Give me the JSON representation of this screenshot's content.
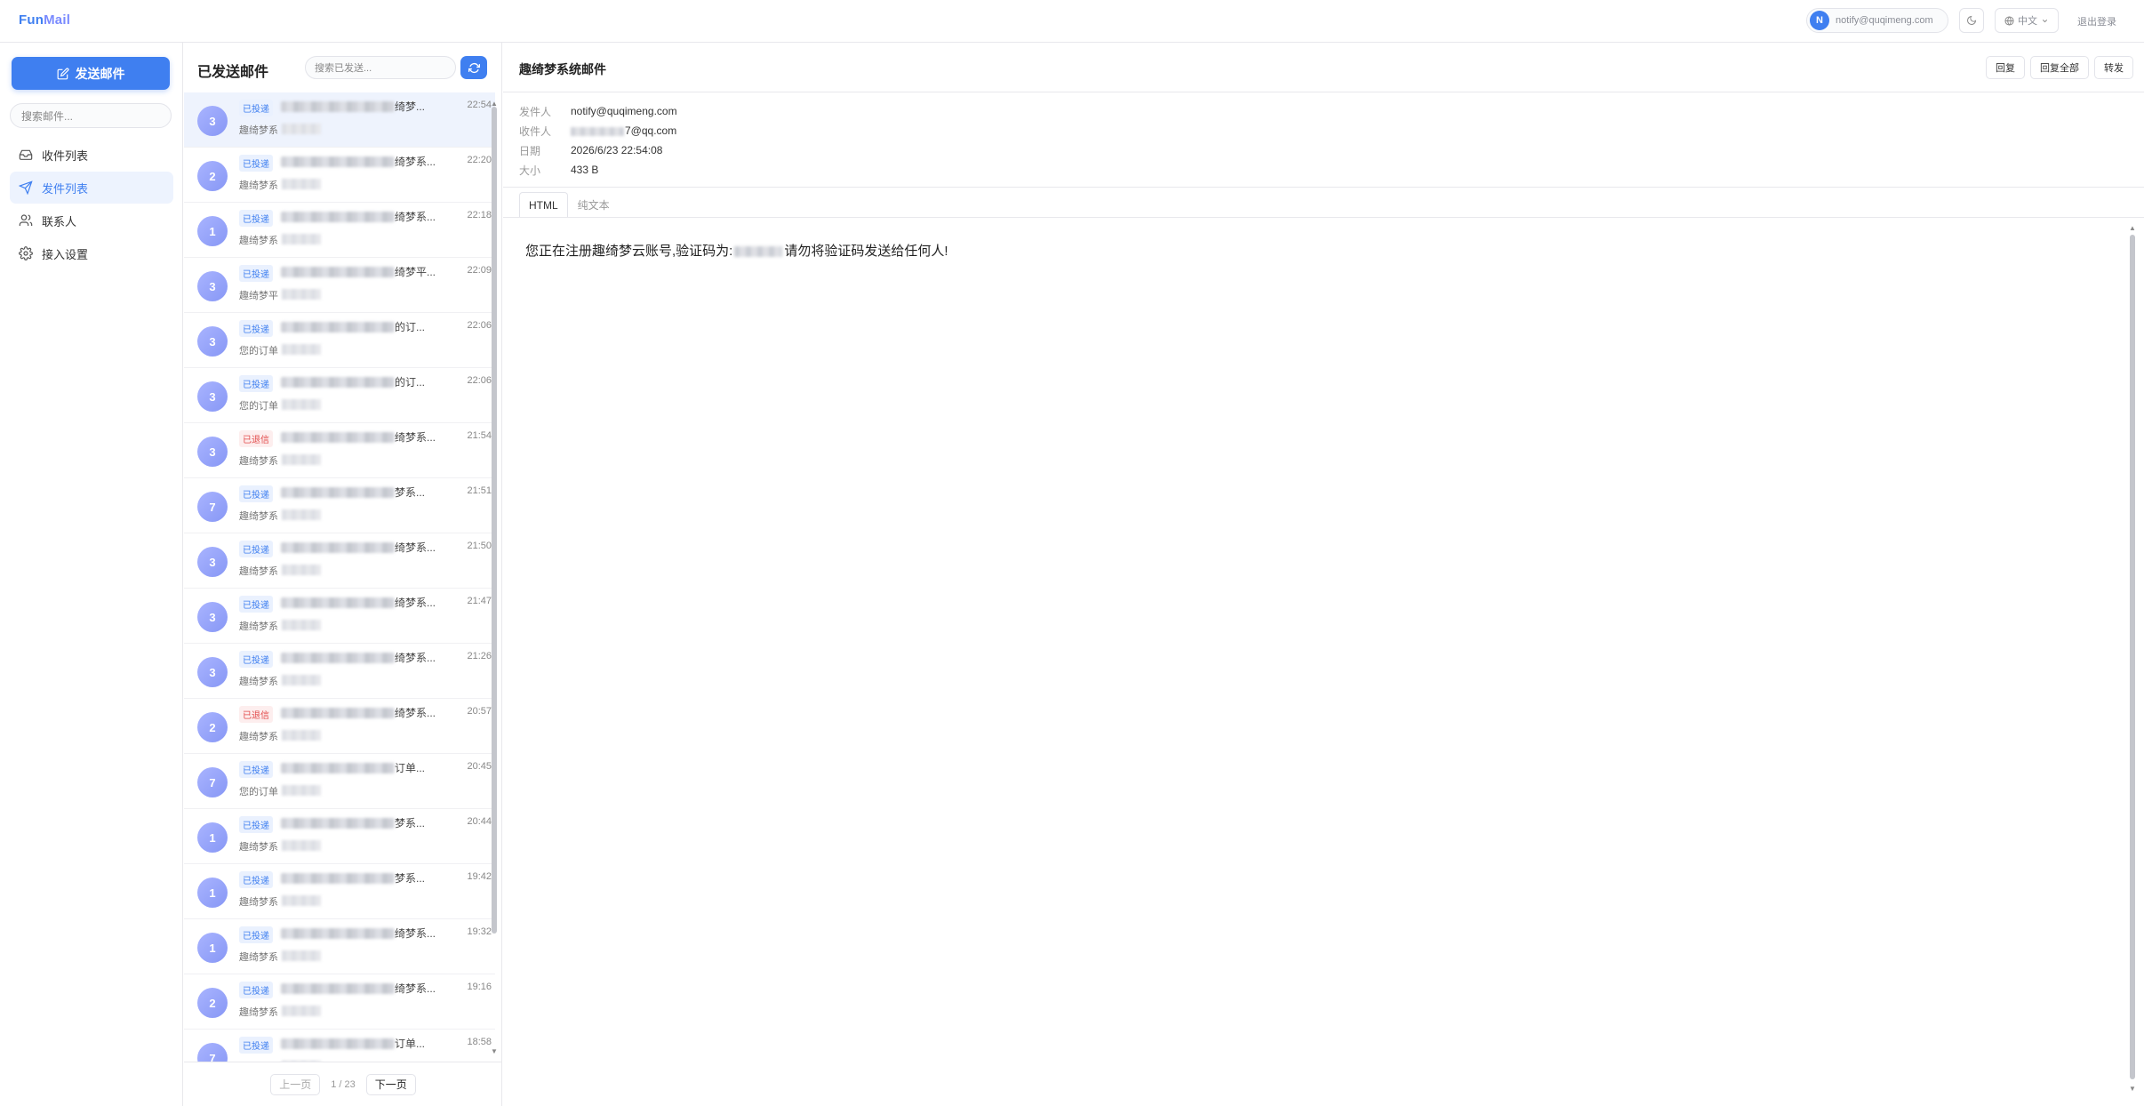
{
  "app": {
    "logo_main": "Fun",
    "logo_accent": "Mail"
  },
  "topbar": {
    "user_initial": "N",
    "user_email": "notify@quqimeng.com",
    "lang_label": "中文",
    "logout_label": "退出登录"
  },
  "sidebar": {
    "compose_label": "发送邮件",
    "search_placeholder": "搜索邮件...",
    "items": [
      {
        "label": "收件列表",
        "icon": "inbox-icon"
      },
      {
        "label": "发件列表",
        "icon": "send-icon"
      },
      {
        "label": "联系人",
        "icon": "contacts-icon"
      },
      {
        "label": "接入设置",
        "icon": "gear-icon"
      }
    ]
  },
  "list": {
    "title": "已发送邮件",
    "search_placeholder": "搜索已发送...",
    "items": [
      {
        "count": "3",
        "status": "已投递",
        "subject": "绮梦...",
        "time": "22:54",
        "from": "趣绮梦系"
      },
      {
        "count": "2",
        "status": "已投递",
        "subject": "绮梦系...",
        "time": "22:20",
        "from": "趣绮梦系"
      },
      {
        "count": "1",
        "status": "已投递",
        "subject": "绮梦系...",
        "time": "22:18",
        "from": "趣绮梦系"
      },
      {
        "count": "3",
        "status": "已投递",
        "subject": "绮梦平...",
        "time": "22:09",
        "from": "趣绮梦平"
      },
      {
        "count": "3",
        "status": "已投递",
        "subject": "的订...",
        "time": "22:06",
        "from": "您的订单"
      },
      {
        "count": "3",
        "status": "已投递",
        "subject": "的订...",
        "time": "22:06",
        "from": "您的订单"
      },
      {
        "count": "3",
        "status": "已退信",
        "subject": "绮梦系...",
        "time": "21:54",
        "from": "趣绮梦系"
      },
      {
        "count": "7",
        "status": "已投递",
        "subject": "梦系...",
        "time": "21:51",
        "from": "趣绮梦系"
      },
      {
        "count": "3",
        "status": "已投递",
        "subject": "绮梦系...",
        "time": "21:50",
        "from": "趣绮梦系"
      },
      {
        "count": "3",
        "status": "已投递",
        "subject": "绮梦系...",
        "time": "21:47",
        "from": "趣绮梦系"
      },
      {
        "count": "3",
        "status": "已投递",
        "subject": "绮梦系...",
        "time": "21:26",
        "from": "趣绮梦系"
      },
      {
        "count": "2",
        "status": "已退信",
        "subject": "绮梦系...",
        "time": "20:57",
        "from": "趣绮梦系"
      },
      {
        "count": "7",
        "status": "已投递",
        "subject": "订单...",
        "time": "20:45",
        "from": "您的订单"
      },
      {
        "count": "1",
        "status": "已投递",
        "subject": "梦系...",
        "time": "20:44",
        "from": "趣绮梦系"
      },
      {
        "count": "1",
        "status": "已投递",
        "subject": "梦系...",
        "time": "19:42",
        "from": "趣绮梦系"
      },
      {
        "count": "1",
        "status": "已投递",
        "subject": "绮梦系...",
        "time": "19:32",
        "from": "趣绮梦系"
      },
      {
        "count": "2",
        "status": "已投递",
        "subject": "绮梦系...",
        "time": "19:16",
        "from": "趣绮梦系"
      },
      {
        "count": "7",
        "status": "已投递",
        "subject": "订单...",
        "time": "18:58",
        "from": "您的订单"
      }
    ],
    "pager": {
      "prev": "上一页",
      "info": "1 / 23",
      "next": "下一页"
    }
  },
  "detail": {
    "title": "趣绮梦系统邮件",
    "buttons": {
      "reply": "回复",
      "reply_all": "回复全部",
      "forward": "转发"
    },
    "meta": {
      "from_label": "发件人",
      "from_value": "notify@quqimeng.com",
      "to_label": "收件人",
      "to_value": "7@qq.com",
      "date_label": "日期",
      "date_value": "2026/6/23 22:54:08",
      "size_label": "大小",
      "size_value": "433 B"
    },
    "tabs": {
      "html": "HTML",
      "text": "纯文本"
    },
    "body_before": "您正在注册趣绮梦云账号,验证码为:",
    "body_after": "请勿将验证码发送给任何人!"
  },
  "colors": {
    "accent": "#3f7ff0",
    "delivered": "#3f7ff0",
    "bounced": "#e24a4a"
  }
}
